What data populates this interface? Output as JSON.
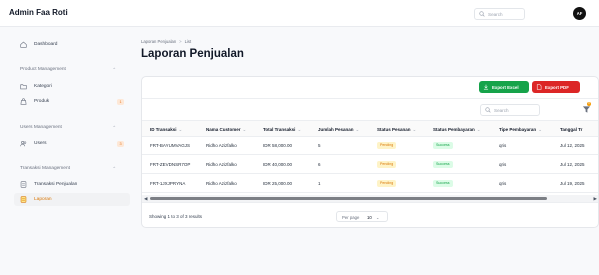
{
  "app": {
    "title": "Admin Faa Roti",
    "search_placeholder": "Search",
    "avatar_initials": "AF"
  },
  "sidebar": {
    "dashboard": "Dashboard",
    "groups": [
      {
        "label": "Product Management",
        "items": [
          {
            "label": "Kategori",
            "icon": "folder-icon"
          },
          {
            "label": "Produk",
            "icon": "bag-icon",
            "badge": "1"
          }
        ]
      },
      {
        "label": "Users Management",
        "items": [
          {
            "label": "Users",
            "icon": "users-icon",
            "badge": "3"
          }
        ]
      },
      {
        "label": "Transaksi Management",
        "items": [
          {
            "label": "Transaksi Penjualan",
            "icon": "document-icon"
          },
          {
            "label": "Laporan",
            "icon": "report-icon",
            "active": true
          }
        ]
      }
    ]
  },
  "breadcrumb": {
    "parent": "Laporan Penjualan",
    "separator": ">",
    "current": "List"
  },
  "page": {
    "title": "Laporan Penjualan"
  },
  "actions": {
    "export_excel": "Export Excel",
    "export_pdf": "Export PDF"
  },
  "table": {
    "search_placeholder": "Search",
    "filter_count": "0",
    "columns": [
      "ID Transaksi",
      "Nama Customer",
      "Total Transaksi",
      "Jumlah Pesanan",
      "Status Pesanan",
      "Status Pembayaran",
      "Tipe Pembayaran",
      "Tanggal Tr"
    ],
    "rows": [
      {
        "id": "FRT-BAYUMVAGJS",
        "customer": "Ridho Azizfalko",
        "total": "IDR 58,000.00",
        "qty": "5",
        "status_pesanan": "Pending",
        "status_pembayaran": "Success",
        "tipe": "qris",
        "tanggal": "Jul 12, 2025"
      },
      {
        "id": "FRT-ZEVDNSR7OP",
        "customer": "Ridho Azizfalko",
        "total": "IDR 40,000.00",
        "qty": "6",
        "status_pesanan": "Pending",
        "status_pembayaran": "Success",
        "tipe": "qris",
        "tanggal": "Jul 12, 2025"
      },
      {
        "id": "FRT-1JXJPRYNA",
        "customer": "Ridho Azizfalko",
        "total": "IDR 25,000.00",
        "qty": "1",
        "status_pesanan": "Pending",
        "status_pembayaran": "Success",
        "tipe": "qris",
        "tanggal": "Jul 19, 2025"
      }
    ],
    "footer": {
      "showing": "Showing 1 to 3 of 3 results",
      "per_page_label": "Per page",
      "per_page_value": "10"
    }
  },
  "colors": {
    "accent": "#d97706",
    "excel": "#16a34a",
    "pdf": "#dc2626",
    "pending": "#d97706",
    "success": "#16a34a"
  }
}
